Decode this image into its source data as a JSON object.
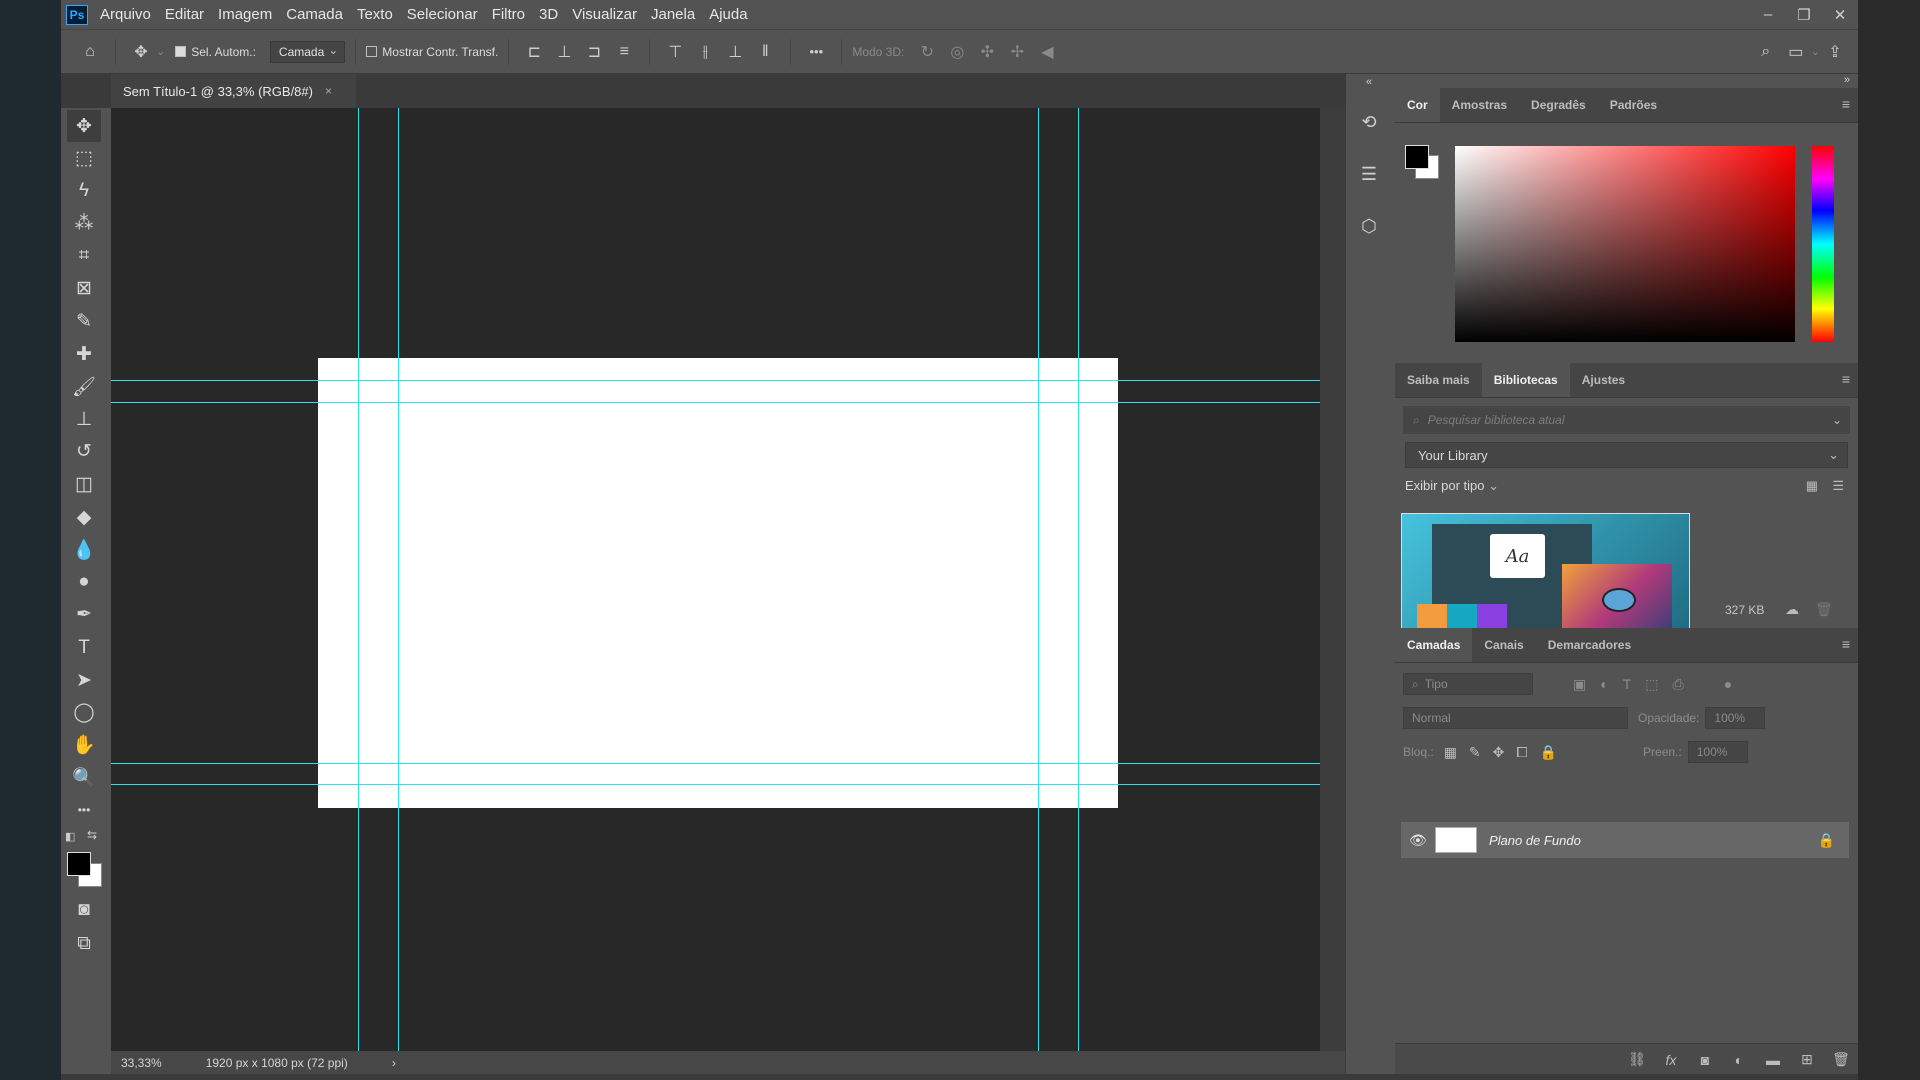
{
  "app": {
    "logo": "Ps"
  },
  "menu": [
    "Arquivo",
    "Editar",
    "Imagem",
    "Camada",
    "Texto",
    "Selecionar",
    "Filtro",
    "3D",
    "Visualizar",
    "Janela",
    "Ajuda"
  ],
  "window_controls": {
    "minimize": "–",
    "restore": "❐",
    "close": "✕"
  },
  "options_bar": {
    "auto_select_label": "Sel. Autom.:",
    "auto_select_checked": true,
    "auto_select_target": "Camada",
    "show_transform_label": "Mostrar Contr. Transf.",
    "show_transform_checked": false,
    "more": "•••",
    "mode3d_label": "Modo 3D:"
  },
  "document": {
    "tab_title": "Sem Título-1 @ 33,3% (RGB/8#)",
    "close": "×",
    "zoom": "33,33%",
    "size_info": "1920 px x 1080 px (72 ppi)",
    "status_arrow": "›"
  },
  "toolbar": {
    "collapse": "»",
    "tools": [
      "move-icon",
      "marquee-icon",
      "lasso-icon",
      "magic-wand-icon",
      "crop-icon",
      "frame-icon",
      "eyedropper-icon",
      "healing-brush-icon",
      "brush-icon",
      "clone-stamp-icon",
      "history-brush-icon",
      "eraser-icon",
      "paint-bucket-icon",
      "blur-icon",
      "dodge-icon",
      "pen-icon",
      "type-icon",
      "path-selection-icon",
      "ellipse-icon",
      "hand-icon",
      "zoom-icon",
      "more-tools-icon"
    ],
    "tool_glyphs": [
      "✥",
      "⬚",
      "ϟ",
      "⁂",
      "⌗",
      "⊠",
      "✎",
      "✚",
      "🖌",
      "⊥",
      "↺",
      "◫",
      "◆",
      "💧",
      "●",
      "✒",
      "T",
      "➤",
      "◯",
      "✋",
      "🔍",
      "•••"
    ]
  },
  "colors": {
    "foreground": "#000000",
    "background": "#ffffff",
    "guide": "#2fe0ef",
    "canvas": "#282828"
  },
  "color_panel": {
    "tabs": [
      "Cor",
      "Amostras",
      "Degradês",
      "Padrões"
    ],
    "active": "Cor"
  },
  "libraries_panel": {
    "tabs": [
      "Saiba mais",
      "Bibliotecas",
      "Ajustes"
    ],
    "active": "Bibliotecas",
    "search_placeholder": "Pesquisar biblioteca atual",
    "library": "Your Library",
    "view_by": "Exibir por tipo",
    "card_glyph": "Aa",
    "size": "327 KB"
  },
  "layers_panel": {
    "tabs": [
      "Camadas",
      "Canais",
      "Demarcadores"
    ],
    "active": "Camadas",
    "filter_placeholder": "Tipo",
    "blend_mode": "Normal",
    "opacity_label": "Opacidade:",
    "opacity": "100%",
    "lock_label": "Bloq.:",
    "fill_label": "Preen.:",
    "fill": "100%",
    "layers": [
      {
        "name": "Plano de Fundo",
        "visible": true,
        "locked": true
      }
    ]
  }
}
